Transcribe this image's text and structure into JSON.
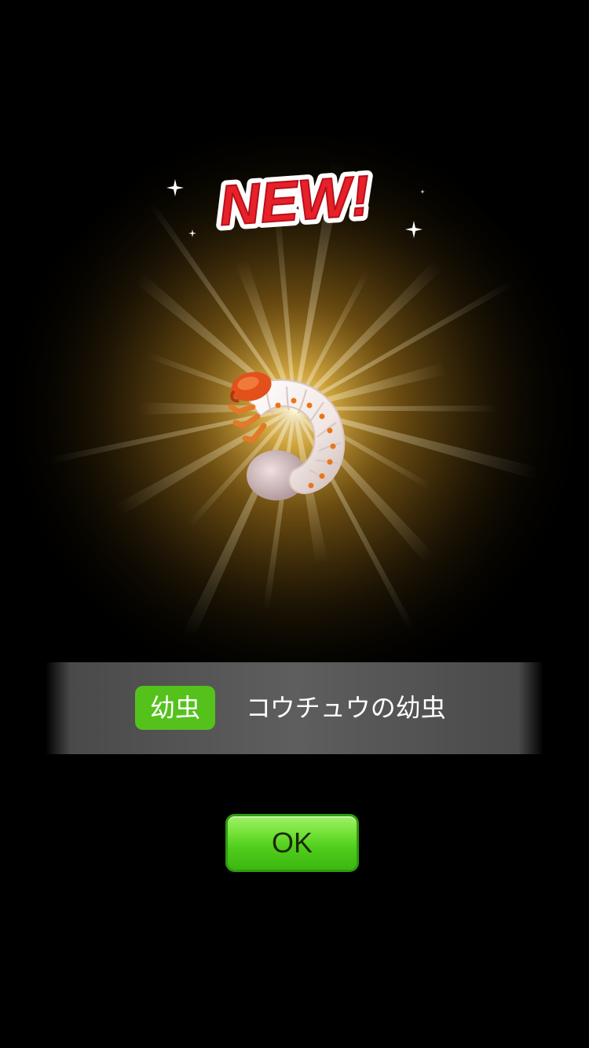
{
  "reveal": {
    "badge_text": "NEW!",
    "creature_icon": "grub-icon"
  },
  "info": {
    "category_tag": "幼虫",
    "creature_name": "コウチュウの幼虫"
  },
  "actions": {
    "ok_label": "OK"
  },
  "colors": {
    "background": "#000000",
    "glow": "#f6c23e",
    "badge_red": "#e8202a",
    "tag_green": "#55c21c",
    "button_green": "#4fcc1c",
    "info_bar": "#5e5e5e"
  }
}
